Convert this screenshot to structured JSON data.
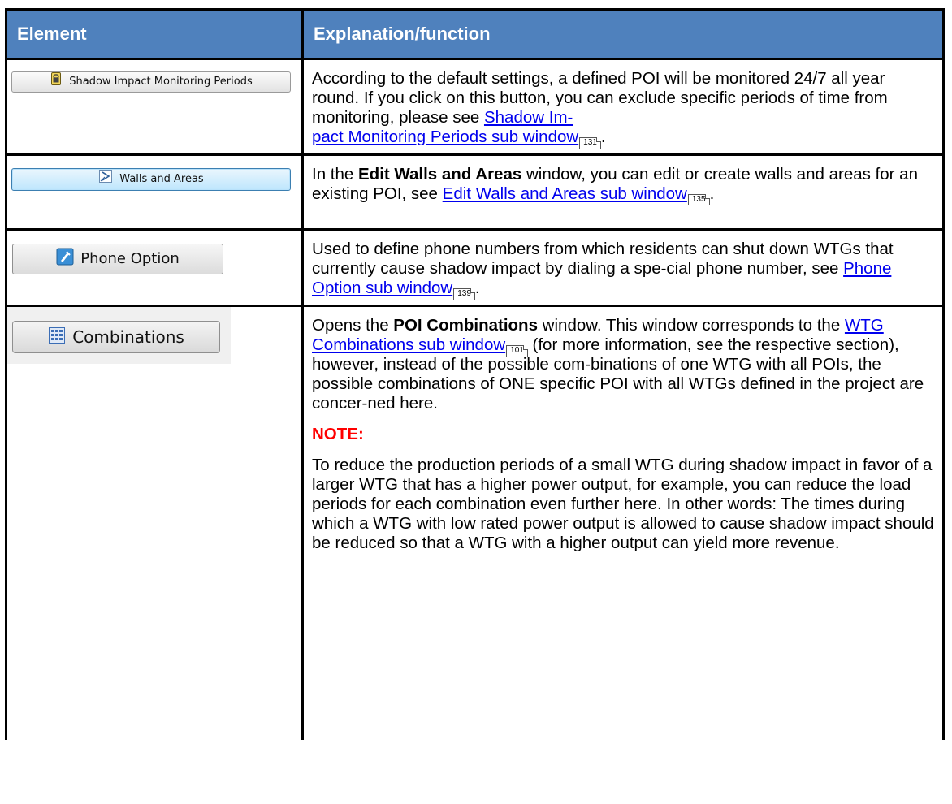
{
  "header": {
    "element": "Element",
    "explanation": "Explanation/function"
  },
  "rows": [
    {
      "button": {
        "label": "Shadow Impact Monitoring Periods",
        "icon": "lock-icon"
      },
      "text_pre": "According to the default settings, a defined POI will be monitored 24/7 all year round. If you click on this button, you can exclude specific periods of time from monitoring, please see ",
      "link": "Shadow Impact Monitoring Periods sub window",
      "link_display_1": "Shadow Im-",
      "link_display_2": "pact Monitoring Periods sub window",
      "page_ref": "131",
      "text_post": "."
    },
    {
      "button": {
        "label": "Walls and Areas",
        "icon": "walls-icon"
      },
      "text_pre_a": "In the ",
      "bold": "Edit Walls and Areas",
      "text_pre_b": " window, you can edit or create walls and areas for an existing POI, see ",
      "link": "Edit Walls and Areas sub window",
      "page_ref": "135",
      "text_post": "."
    },
    {
      "button": {
        "label": "Phone Option",
        "icon": "phone-icon"
      },
      "text_pre": "Used to define phone numbers from which residents can shut down WTGs that currently cause shadow impact by dialing a spe-cial phone number, see ",
      "link": "Phone Option sub window",
      "page_ref": "139",
      "text_post": "."
    },
    {
      "button": {
        "label": "Combinations",
        "icon": "grid-icon"
      },
      "text_pre_a": "Opens the ",
      "bold": "POI Combinations",
      "text_pre_b": " window. This window corresponds to the ",
      "link": "WTG Combinations sub window",
      "page_ref": "101",
      "text_post": " (for more information, see the respective section), however, instead of the possible com-binations of one WTG with all POIs, the possible combinations of ONE specific POI with all WTGs defined in the project are concer-ned here.",
      "note_label": "NOTE:",
      "note_text": "To reduce the production periods of a small WTG during shadow impact in favor of a larger WTG that has a higher power output, for example, you can reduce the load periods for each combination even further here. In other words: The times during which a WTG with low rated power output is allowed to cause shadow impact should be reduced so that a WTG with a higher output can yield more revenue."
    }
  ],
  "colors": {
    "header_bg": "#4f81bd",
    "link": "#0000ee",
    "note": "#ff0000"
  }
}
